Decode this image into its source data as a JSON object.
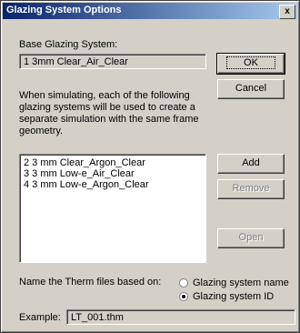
{
  "window": {
    "title": "Glazing System Options",
    "close_glyph": "x"
  },
  "base": {
    "label": "Base Glazing System:",
    "value": "1 3mm Clear_Air_Clear"
  },
  "buttons": {
    "ok": "OK",
    "cancel": "Cancel",
    "add": "Add",
    "remove": "Remove",
    "open": "Open"
  },
  "description": "When simulating, each of the following glazing systems will be used to create a separate simulation with the same frame geometry.",
  "glazing_list": [
    "2 3 mm Clear_Argon_Clear",
    "3 3 mm Low-e_Air_Clear",
    "4 3 mm Low-e_Argon_Clear"
  ],
  "naming": {
    "label": "Name the Therm files based on:",
    "options": [
      {
        "label": "Glazing system name",
        "selected": false
      },
      {
        "label": "Glazing system ID",
        "selected": true
      }
    ]
  },
  "example": {
    "label": "Example:",
    "value": "LT_001.thm"
  }
}
